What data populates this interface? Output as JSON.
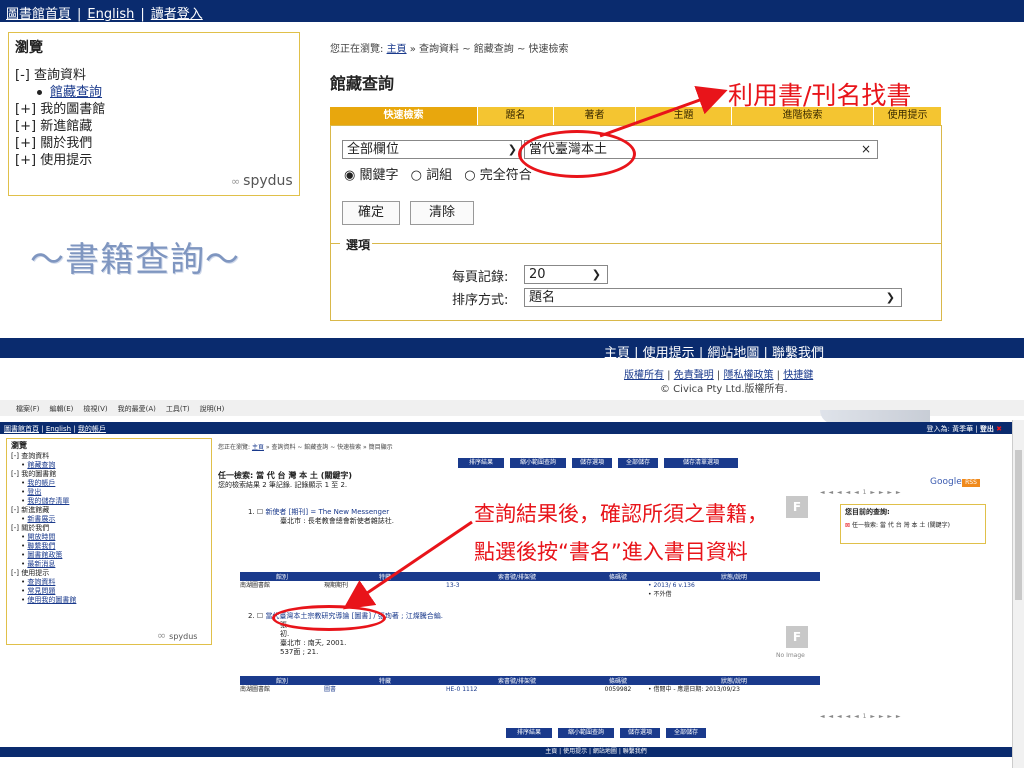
{
  "top": {
    "nav_links": [
      "圖書館首頁",
      "English",
      "讀者登入"
    ],
    "browse": {
      "title": "瀏覽",
      "items": [
        {
          "toggle": "[-]",
          "label": "查詢資料"
        },
        {
          "toggle": "[+]",
          "label": "我的圖書館"
        },
        {
          "toggle": "[+]",
          "label": "新進館藏"
        },
        {
          "toggle": "[+]",
          "label": "關於我們"
        },
        {
          "toggle": "[+]",
          "label": "使用提示"
        }
      ],
      "sub_item": "館藏查詢"
    },
    "brand": "spydus",
    "deco_text": "～書籍查詢～",
    "breadcrumb": {
      "prefix": "您正在瀏覽:",
      "home": "主頁",
      "rest": "» 查詢資料 ~ 館藏查詢 ~ 快速檢索"
    },
    "page_title": "館藏查詢",
    "tabs": [
      "快速檢索",
      "題名",
      "著者",
      "主題",
      "進階檢索",
      "使用提示"
    ],
    "field_select": "全部欄位",
    "query_value": "當代臺灣本土",
    "radios": [
      "關鍵字",
      "詞組",
      "完全符合"
    ],
    "confirm_label": "確定",
    "clear_label": "清除",
    "options_label": "選項",
    "per_page_label": "每頁記錄:",
    "per_page_value": "20",
    "sort_label": "排序方式:",
    "sort_value": "題名",
    "annotation": "利用書/刊名找書",
    "footer_links": [
      "主頁",
      "使用提示",
      "網站地圖",
      "聯繫我們"
    ],
    "footer_legal": [
      "版權所有",
      "免責聲明",
      "隱私權政策",
      "快捷鍵"
    ],
    "copyright": "© Civica Pty Ltd.版權所有."
  },
  "bottom": {
    "menubar": [
      "檔案(F)",
      "編輯(E)",
      "檢視(V)",
      "我的最愛(A)",
      "工具(T)",
      "說明(H)"
    ],
    "nav_links": [
      "圖書館首頁",
      "English",
      "我的帳戶"
    ],
    "login_text": "登入為: 黃季華",
    "logout_label": "登出",
    "browse": {
      "title": "瀏覽",
      "groups": [
        {
          "head": "[-] 查詢資料",
          "subs": [
            "館藏查詢"
          ]
        },
        {
          "head": "[-] 我的圖書館",
          "subs": [
            "我的帳戶",
            "登出",
            "我的儲存清單"
          ]
        },
        {
          "head": "[-] 新進館藏",
          "subs": [
            "新書展示"
          ]
        },
        {
          "head": "[-] 關於我們",
          "subs": [
            "開放時間",
            "聯繫我們",
            "圖書館政策",
            "最新消息"
          ]
        },
        {
          "head": "[-] 使用提示",
          "subs": [
            "查詢資料",
            "常見問題",
            "使用我的圖書館"
          ]
        }
      ]
    },
    "breadcrumb": {
      "prefix": "您正在瀏覽:",
      "home": "主頁",
      "rest": "» 查詢資料 ~ 館藏查詢 ~ 快速檢索 » 簡目顯示"
    },
    "toolbar": [
      "排序結果",
      "縮小範圍查詢",
      "儲存選項",
      "全部儲存",
      "儲存清單選項"
    ],
    "heading": "任一檢索: 當 代 台 灣 本 土 (關鍵字)",
    "count": "您的檢索結果 2 筆記錄. 記錄顯示 1 至 2.",
    "google": "Google",
    "rss": "RSS",
    "side_title": "您目前的查詢:",
    "side_text": "任一檢索: 當 代 台 灣 本 土 (關鍵字)",
    "records": [
      {
        "num": "1.",
        "title": "新使者 [期刊] = The New Messenger",
        "pub": "臺北市 : 長老教會總會新使者雜誌社."
      },
      {
        "num": "2.",
        "title": "當代臺灣本土宗教研究導論 [圖書] / 張珣著 ; 江燦騰合編.",
        "extra": "張.",
        "ed": "初.",
        "pub": "臺北市 : 南天, 2001.",
        "pages": "537面 ; 21."
      }
    ],
    "hold_headers": [
      "館別",
      "特藏",
      "索書號/排架號",
      "條碼號",
      "狀態/說明"
    ],
    "hold1": [
      "南湖圖書館",
      "現期期刊",
      "13-3",
      "",
      "• 2013/ 6 v.136",
      "• 不外借"
    ],
    "hold2": [
      "南湖圖書館",
      "圖書",
      "HE-0 1112",
      "0059982",
      "• 借閱中 - 應還日期: 2013/09/23"
    ],
    "no_image": "No Image",
    "footer": "主頁 | 使用提示 | 網站地圖 | 聯繫我們",
    "annotation_line1": "查詢結果後，確認所須之書籍，",
    "annotation_line2": "點選後按“書名”進入書目資料"
  }
}
